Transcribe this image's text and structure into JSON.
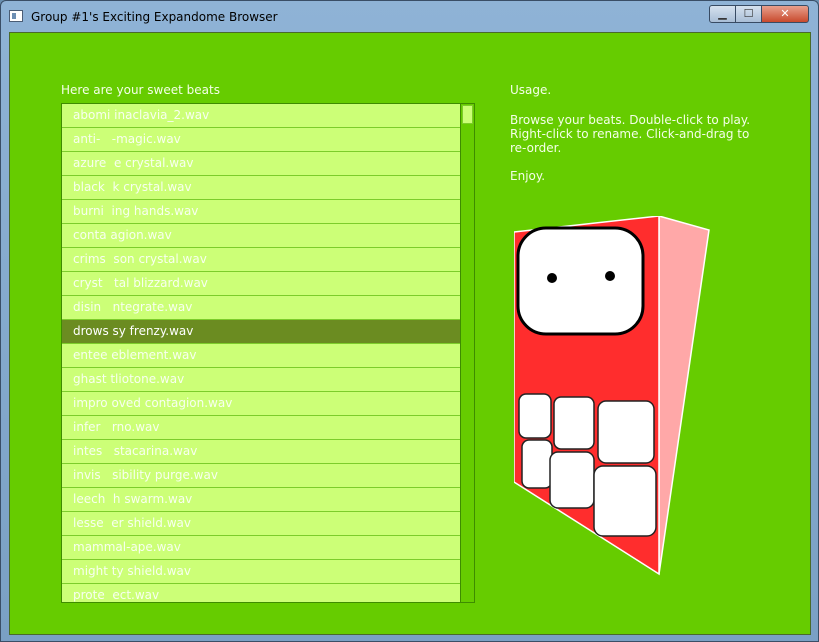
{
  "window": {
    "title": "Group #1's Exciting Expandome Browser",
    "controls": {
      "minimize": "▁",
      "maximize": "☐",
      "close": "✕"
    }
  },
  "list": {
    "heading": "Here are your sweet beats",
    "items": [
      "abomi inaclavia_2.wav",
      "anti-   -magic.wav",
      "azure  e crystal.wav",
      "black  k crystal.wav",
      "burni  ing hands.wav",
      "conta agion.wav",
      "crims  son crystal.wav",
      "cryst   tal blizzard.wav",
      "disin   ntegrate.wav",
      "drows sy frenzy.wav",
      "entee eblement.wav",
      "ghast tliotone.wav",
      "impro oved contagion.wav",
      "infer   rno.wav",
      "intes   stacarina.wav",
      "invis   sibility purge.wav",
      "leech  h swarm.wav",
      "lesse  er shield.wav",
      "mammal-ape.wav",
      "might ty shield.wav",
      "prote  ect.wav"
    ],
    "selected_index": 9
  },
  "usage": {
    "heading": "Usage.",
    "instructions": "Browse your beats. Double-click to play. Right-click to rename. Click-and-drag to re-order.",
    "closing": "Enjoy."
  },
  "colors": {
    "background": "#66cc00",
    "list_background": "#ccff77",
    "selected_row": "#6b8c21",
    "mascot_red": "#ff2d2d",
    "mascot_side": "#ffa8a8"
  },
  "icons": {
    "app": "window-app-icon",
    "mascot": "red-cube-monster-mascot"
  }
}
